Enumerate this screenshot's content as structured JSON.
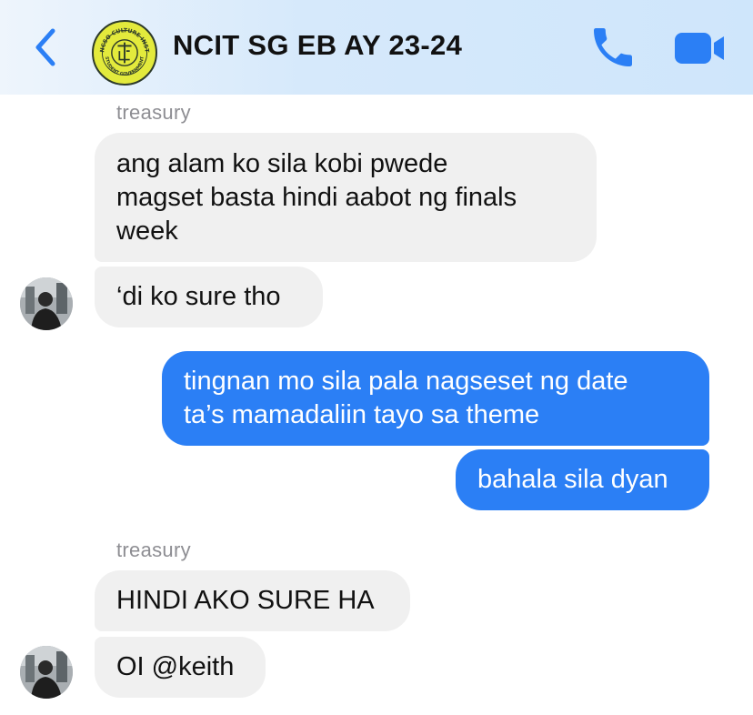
{
  "header": {
    "title": "NCIT SG EB AY 23-24",
    "logo_text_top": "NCSO CULTURE INST",
    "logo_text_bottom": "STUDENT GOVERNMENT",
    "logo_initials": "NCIT",
    "colors": {
      "accent": "#2b7ff5",
      "logo_bg": "#e3ea3c"
    },
    "icons": {
      "back": "chevron-left-icon",
      "call": "phone-icon",
      "video": "video-camera-icon"
    }
  },
  "messages": [
    {
      "sender": "treasury"
    },
    {
      "direction": "incoming",
      "lines": [
        "ang alam ko sila kobi pwede",
        "magset basta hindi aabot ng finals",
        "week"
      ]
    },
    {
      "direction": "incoming",
      "lines": [
        "‘di ko sure tho"
      ]
    },
    {
      "direction": "outgoing",
      "lines": [
        "tingnan mo sila pala nagseset ng date",
        "ta’s mamadaliin tayo sa theme"
      ]
    },
    {
      "direction": "outgoing",
      "lines": [
        "bahala sila dyan"
      ]
    },
    {
      "sender": "treasury"
    },
    {
      "direction": "incoming",
      "lines": [
        "HINDI AKO SURE HA"
      ]
    },
    {
      "direction": "incoming",
      "lines": [
        "OI @keith"
      ]
    }
  ],
  "colors": {
    "incoming_bubble": "#f0f0f0",
    "outgoing_bubble": "#2b7ff5",
    "sender_name": "#8e8e93"
  }
}
